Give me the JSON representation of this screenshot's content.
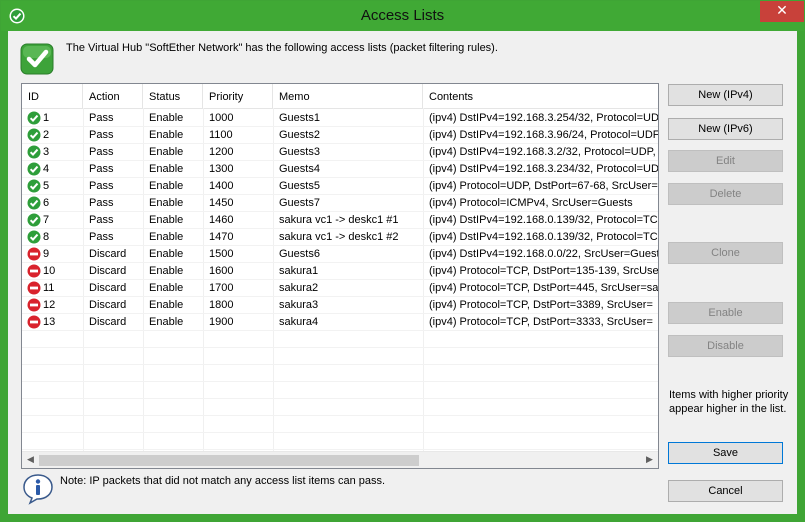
{
  "window": {
    "title": "Access Lists",
    "close_label": "✕"
  },
  "header": {
    "text": "The Virtual Hub \"SoftEther Network\" has the following access lists (packet filtering rules)."
  },
  "columns": [
    "ID",
    "Action",
    "Status",
    "Priority",
    "Memo",
    "Contents"
  ],
  "rows": [
    {
      "icon": "pass-check-icon",
      "id": "1",
      "action": "Pass",
      "status": "Enable",
      "priority": "1000",
      "memo": "Guests1",
      "contents": "(ipv4) DstIPv4=192.168.3.254/32, Protocol=UD"
    },
    {
      "icon": "pass-check-icon",
      "id": "2",
      "action": "Pass",
      "status": "Enable",
      "priority": "1100",
      "memo": "Guests2",
      "contents": "(ipv4) DstIPv4=192.168.3.96/24, Protocol=UDF"
    },
    {
      "icon": "pass-check-icon",
      "id": "3",
      "action": "Pass",
      "status": "Enable",
      "priority": "1200",
      "memo": "Guests3",
      "contents": "(ipv4) DstIPv4=192.168.3.2/32, Protocol=UDP,"
    },
    {
      "icon": "pass-check-icon",
      "id": "4",
      "action": "Pass",
      "status": "Enable",
      "priority": "1300",
      "memo": "Guests4",
      "contents": "(ipv4) DstIPv4=192.168.3.234/32, Protocol=UD"
    },
    {
      "icon": "pass-check-icon",
      "id": "5",
      "action": "Pass",
      "status": "Enable",
      "priority": "1400",
      "memo": "Guests5",
      "contents": "(ipv4) Protocol=UDP, DstPort=67-68, SrcUser="
    },
    {
      "icon": "pass-check-icon",
      "id": "6",
      "action": "Pass",
      "status": "Enable",
      "priority": "1450",
      "memo": "Guests7",
      "contents": "(ipv4) Protocol=ICMPv4, SrcUser=Guests"
    },
    {
      "icon": "pass-check-icon",
      "id": "7",
      "action": "Pass",
      "status": "Enable",
      "priority": "1460",
      "memo": "sakura vc1 -> deskc1 #1",
      "contents": "(ipv4) DstIPv4=192.168.0.139/32, Protocol=TC"
    },
    {
      "icon": "pass-check-icon",
      "id": "8",
      "action": "Pass",
      "status": "Enable",
      "priority": "1470",
      "memo": "sakura vc1 -> deskc1 #2",
      "contents": "(ipv4) DstIPv4=192.168.0.139/32, Protocol=TC"
    },
    {
      "icon": "discard-stop-icon",
      "id": "9",
      "action": "Discard",
      "status": "Enable",
      "priority": "1500",
      "memo": "Guests6",
      "contents": "(ipv4) DstIPv4=192.168.0.0/22, SrcUser=Guests"
    },
    {
      "icon": "discard-stop-icon",
      "id": "10",
      "action": "Discard",
      "status": "Enable",
      "priority": "1600",
      "memo": "sakura1",
      "contents": "(ipv4) Protocol=TCP, DstPort=135-139, SrcUse="
    },
    {
      "icon": "discard-stop-icon",
      "id": "11",
      "action": "Discard",
      "status": "Enable",
      "priority": "1700",
      "memo": "sakura2",
      "contents": "(ipv4) Protocol=TCP, DstPort=445, SrcUser=sa"
    },
    {
      "icon": "discard-stop-icon",
      "id": "12",
      "action": "Discard",
      "status": "Enable",
      "priority": "1800",
      "memo": "sakura3",
      "contents": "(ipv4) Protocol=TCP, DstPort=3389, SrcUser="
    },
    {
      "icon": "discard-stop-icon",
      "id": "13",
      "action": "Discard",
      "status": "Enable",
      "priority": "1900",
      "memo": "sakura4",
      "contents": "(ipv4) Protocol=TCP, DstPort=3333, SrcUser="
    }
  ],
  "buttons": {
    "new_ipv4": "New (IPv4)",
    "new_ipv6": "New (IPv6)",
    "edit": "Edit",
    "delete": "Delete",
    "clone": "Clone",
    "enable": "Enable",
    "disable": "Disable",
    "save": "Save",
    "cancel": "Cancel"
  },
  "side_note": "Items with higher priority appear higher in the list.",
  "footer_note": "Note: IP packets that did not match any access list items can pass.",
  "colors": {
    "accent_green": "#40a935",
    "pass_green": "#2e9e3a",
    "discard_red": "#d9232d",
    "close_red": "#c8413a"
  }
}
